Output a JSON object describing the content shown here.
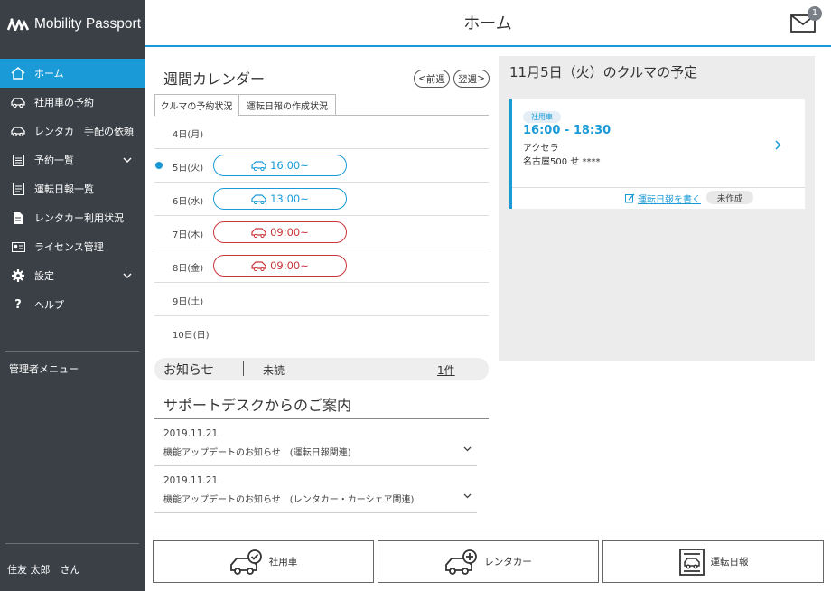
{
  "app": {
    "brand": "Mobility Passport"
  },
  "header": {
    "title": "ホーム",
    "mail_badge": "1"
  },
  "sidebar": {
    "items": [
      {
        "label": "ホーム",
        "icon": "home-icon"
      },
      {
        "label": "社用車の予約",
        "icon": "car-icon"
      },
      {
        "label": "レンタカ　手配の依頼",
        "icon": "car-icon"
      },
      {
        "label": "予約一覧",
        "icon": "list-icon"
      },
      {
        "label": "運転日報一覧",
        "icon": "report-icon"
      },
      {
        "label": "レンタカー利用状況",
        "icon": "document-icon"
      },
      {
        "label": "ライセンス管理",
        "icon": "id-card-icon"
      },
      {
        "label": "設定",
        "icon": "gear-icon"
      },
      {
        "label": "ヘルプ",
        "icon": "question-icon"
      }
    ],
    "admin_menu": "管理者メニュー",
    "user": "住友 太郎　さん"
  },
  "calendar": {
    "title": "週間カレンダー",
    "prev_label": "前週",
    "next_label": "翌週",
    "tabs": [
      "クルマの予約状況",
      "運転日報の作成状況"
    ],
    "days": [
      {
        "label": "4日(月)",
        "time": ""
      },
      {
        "label": "5日(火)",
        "time": "16:00~"
      },
      {
        "label": "6日(水)",
        "time": "13:00~"
      },
      {
        "label": "7日(木)",
        "time": "09:00~"
      },
      {
        "label": "8日(金)",
        "time": "09:00~"
      },
      {
        "label": "9日(土)",
        "time": ""
      },
      {
        "label": "10日(日)",
        "time": ""
      }
    ]
  },
  "notice": {
    "label": "お知らせ",
    "unread": "未読",
    "count": "1件"
  },
  "support": {
    "title": "サポートデスクからのご案内",
    "items": [
      {
        "date": "2019.11.21",
        "text": "機能アップデートのお知らせ　(運転日報関連)"
      },
      {
        "date": "2019.11.21",
        "text": "機能アップデートのお知らせ　(レンタカー・カーシェア関連)"
      }
    ]
  },
  "schedule": {
    "title": "11月5日（火）のクルマの予定",
    "card": {
      "tag": "社用車",
      "time": "16:00 - 18:30",
      "car": "アクセラ",
      "plate": "名古屋500 せ ****",
      "write_link": "運転日報を書く",
      "status": "未作成"
    }
  },
  "bottom": {
    "buttons": [
      "社用車",
      "レンタカー",
      "運転日報"
    ]
  },
  "colors": {
    "accent": "#1a9bd7",
    "sidebar": "#3b4047",
    "reserved_red": "#c9363b"
  }
}
